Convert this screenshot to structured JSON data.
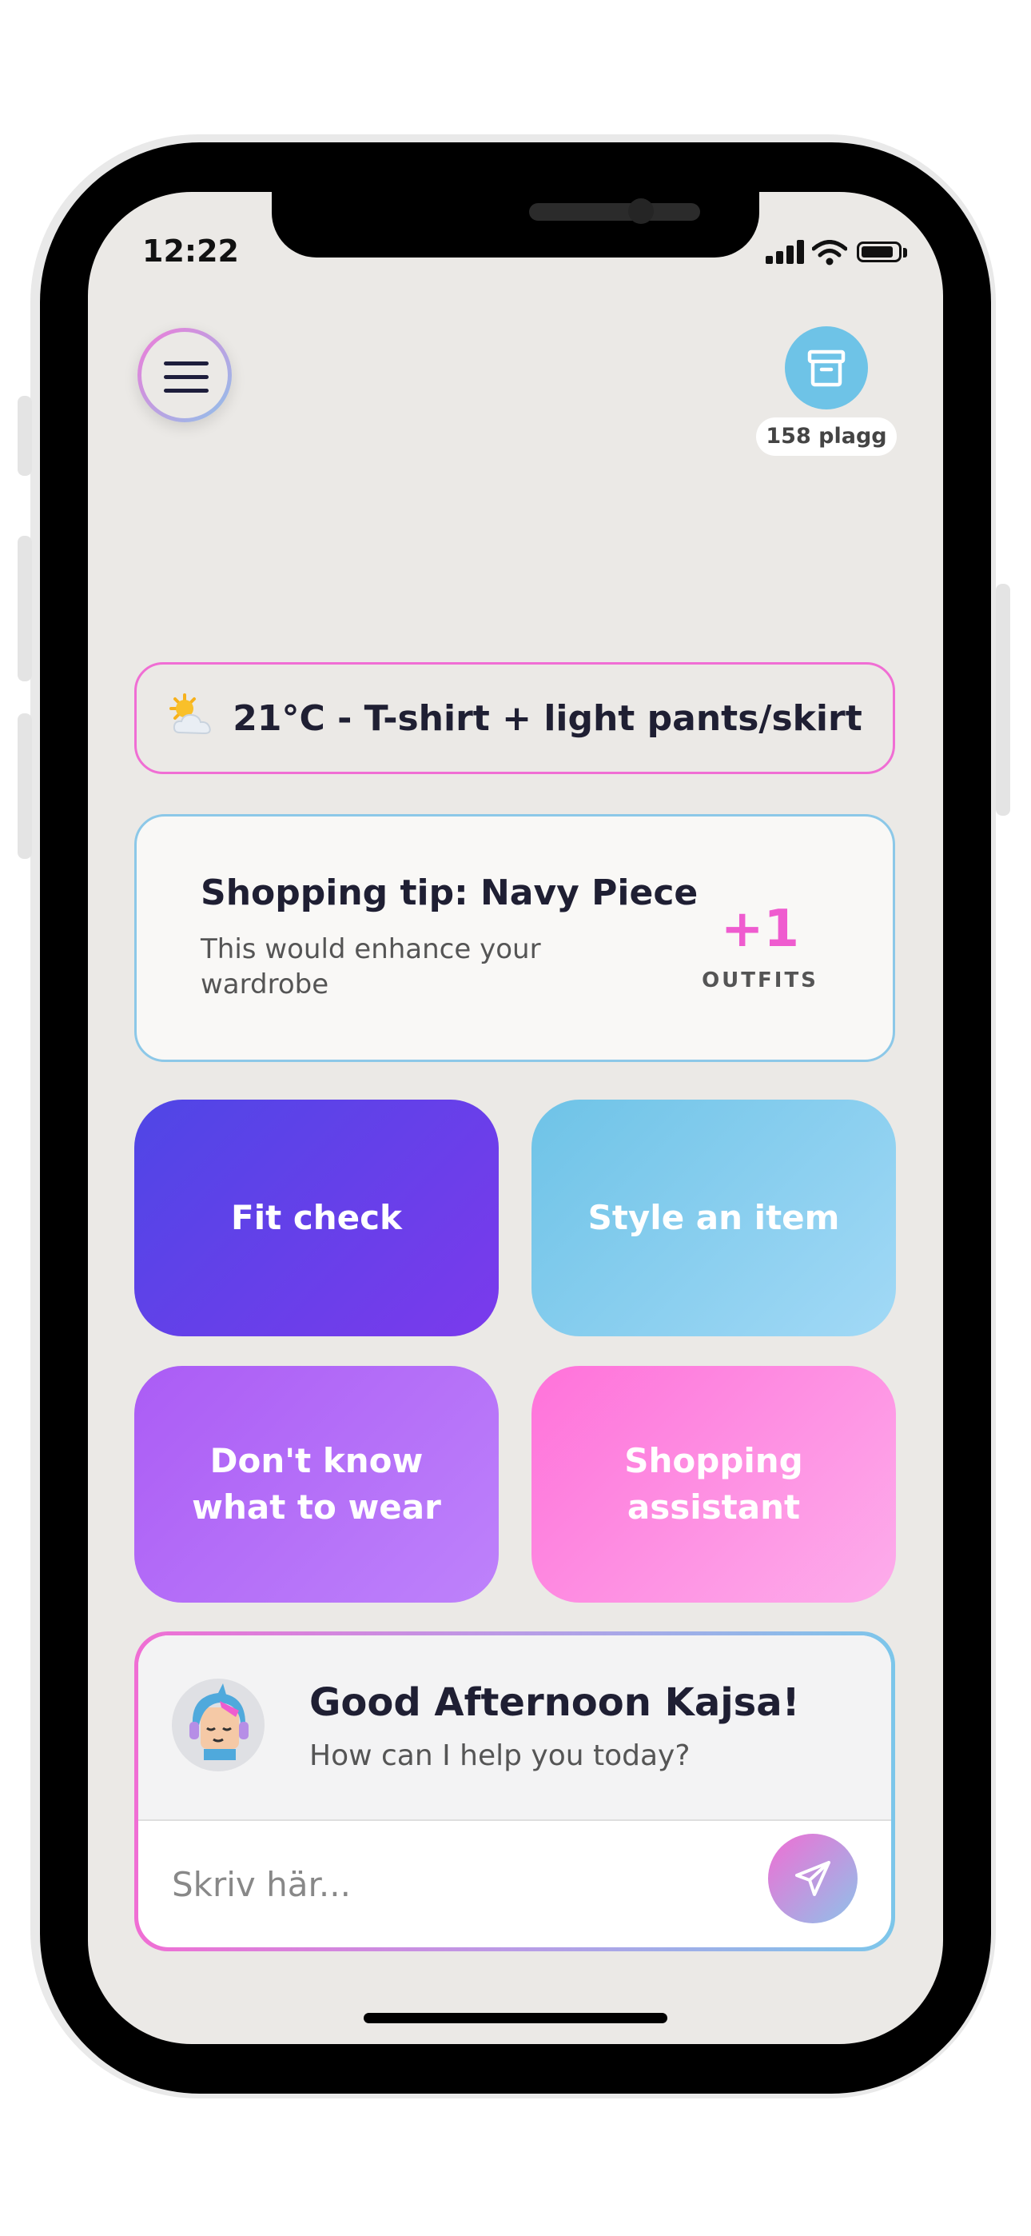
{
  "status_bar": {
    "time": "12:22"
  },
  "header": {
    "wardrobe_count": "158 plagg"
  },
  "weather": {
    "text": "21°C - T-shirt + light pants/skirt",
    "icon": "sun-behind-cloud-icon"
  },
  "shopping_tip": {
    "title": "Shopping tip: Navy Piece",
    "description": "This would enhance your wardrobe",
    "count": "+1",
    "count_label": "OUTFITS"
  },
  "actions": [
    {
      "label": "Fit check",
      "color": "#4f46e6"
    },
    {
      "label": "Style an item",
      "color": "#6ec3e7"
    },
    {
      "label": "Don't know what to wear",
      "color": "#ab5cf5"
    },
    {
      "label": "Shopping assistant",
      "color": "#ff72da"
    }
  ],
  "chat": {
    "greeting": "Good Afternoon Kajsa!",
    "subtitle": "How can I help you today?",
    "placeholder": "Skriv här..."
  },
  "colors": {
    "accent_pink": "#ef5ccf",
    "accent_blue": "#6ec3e7",
    "background": "#ebe9e6"
  }
}
